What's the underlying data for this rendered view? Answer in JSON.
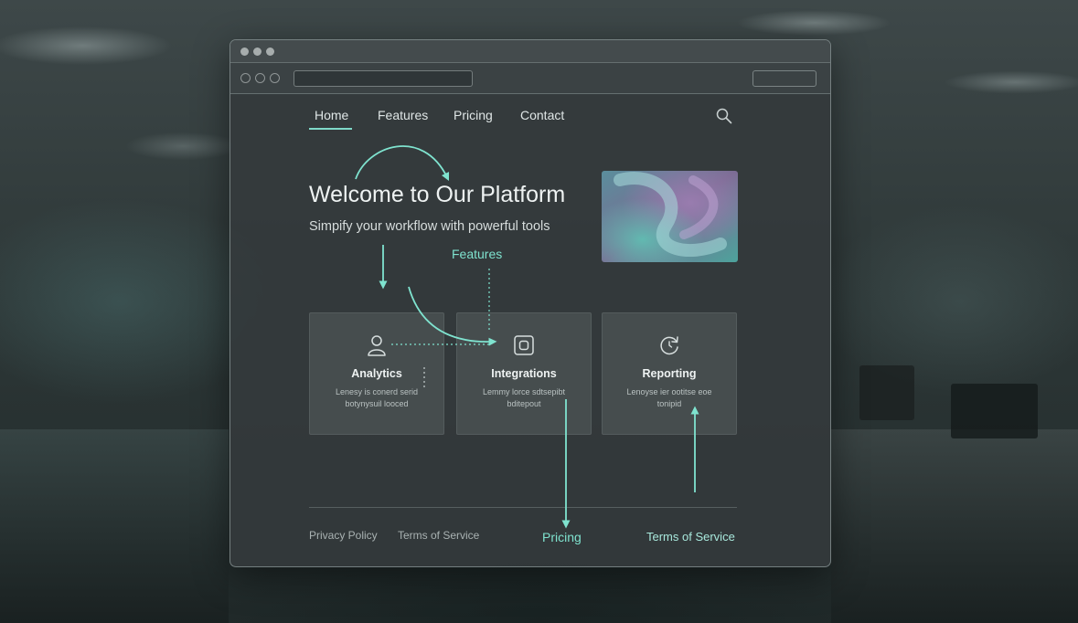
{
  "nav": {
    "items": [
      {
        "label": "Home",
        "active": true
      },
      {
        "label": "Features",
        "active": false
      },
      {
        "label": "Pricing",
        "active": false
      },
      {
        "label": "Contact",
        "active": false
      }
    ],
    "search_icon": "search-icon"
  },
  "hero": {
    "title": "Welcome to Our Platform",
    "subtitle": "Simpify your workflow with powerful tools"
  },
  "cards": [
    {
      "title": "Analytics",
      "desc": "Lenesy is conerd serid botynysuil looced",
      "icon": "user-icon"
    },
    {
      "title": "Integrations",
      "desc": "Lemmy lorce sdtsepibt bditepout",
      "icon": "square-icon"
    },
    {
      "title": "Reporting",
      "desc": "Lenoyse ier ootitse eoe tonipid",
      "icon": "refresh-icon"
    }
  ],
  "footer": {
    "links": [
      "Privacy Policy",
      "Terms of Service"
    ]
  },
  "annotations": {
    "features": "Features",
    "pricing": "Pricing",
    "terms": "Terms of Service"
  },
  "colors": {
    "accent": "#7fd9c9",
    "annotation": "#7fe3cf"
  }
}
